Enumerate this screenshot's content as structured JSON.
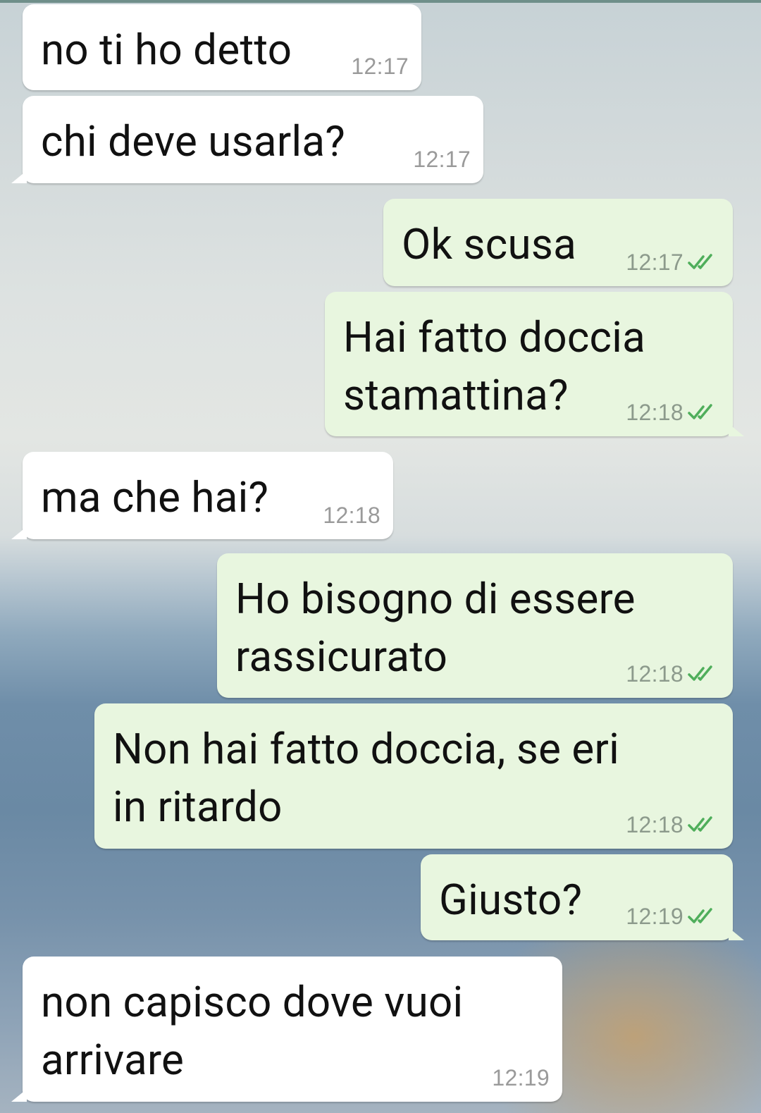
{
  "colors": {
    "incoming_bubble": "#ffffff",
    "outgoing_bubble": "#e8f6df",
    "read_ticks": "#4fae5b",
    "timestamp": "#8c9a8c"
  },
  "icons": {
    "read_receipt": "double-check-icon"
  },
  "messages": [
    {
      "direction": "in",
      "text": "no ti ho detto",
      "time": "12:17"
    },
    {
      "direction": "in",
      "text": "chi deve usarla?",
      "time": "12:17"
    },
    {
      "direction": "out",
      "text": "Ok scusa",
      "time": "12:17",
      "status": "read"
    },
    {
      "direction": "out",
      "text": "Hai fatto doccia\nstamattina?",
      "time": "12:18",
      "status": "read"
    },
    {
      "direction": "in",
      "text": "ma che hai?",
      "time": "12:18"
    },
    {
      "direction": "out",
      "text": "Ho bisogno di essere\nrassicurato",
      "time": "12:18",
      "status": "read"
    },
    {
      "direction": "out",
      "text": "Non hai fatto doccia, se eri\nin ritardo",
      "time": "12:18",
      "status": "read"
    },
    {
      "direction": "out",
      "text": "Giusto?",
      "time": "12:19",
      "status": "read"
    },
    {
      "direction": "in",
      "text": "non capisco dove vuoi\narrivare",
      "time": "12:19"
    }
  ]
}
